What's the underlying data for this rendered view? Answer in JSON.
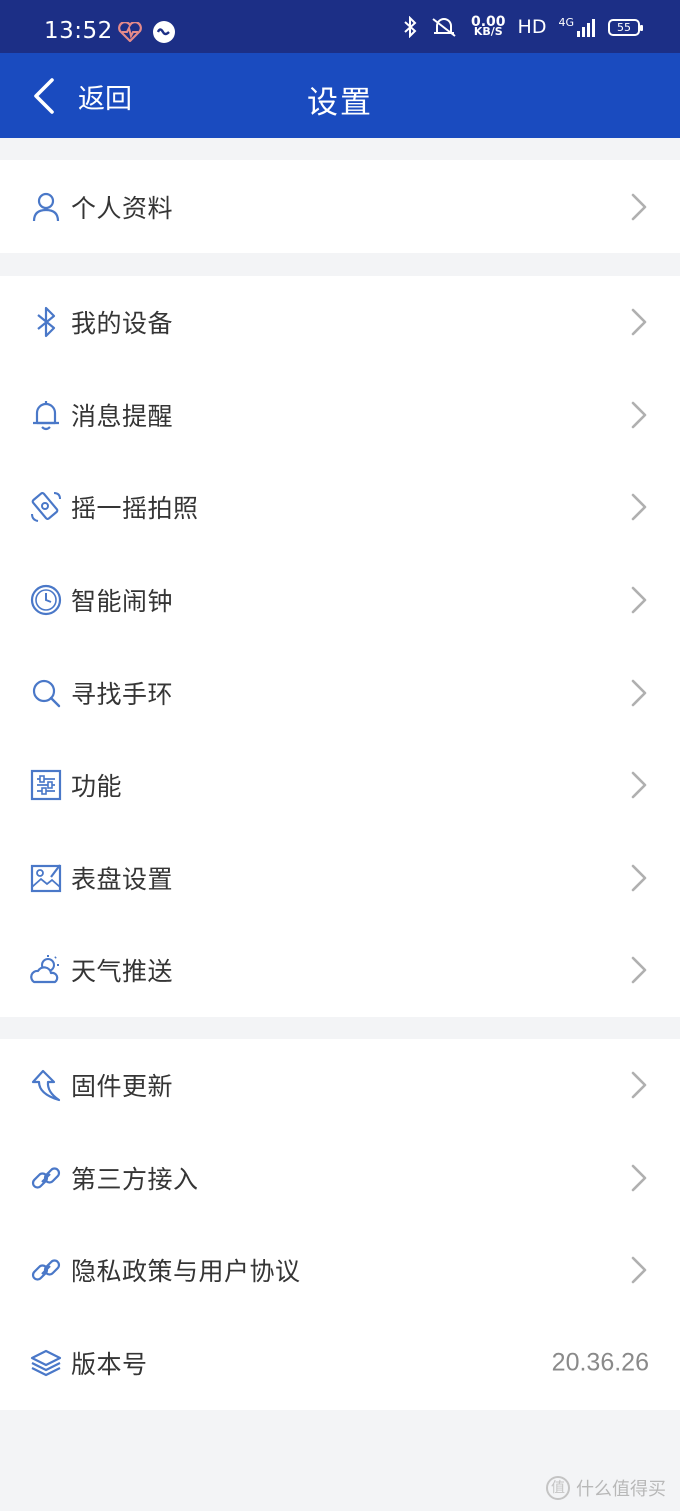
{
  "status_bar": {
    "time": "13:52",
    "speed_value": "0.00",
    "speed_unit": "KB/S",
    "hd": "HD",
    "network": "4G",
    "battery": "55"
  },
  "header": {
    "back_label": "返回",
    "title": "设置"
  },
  "groups": [
    {
      "items": [
        {
          "label": "个人资料",
          "icon": "person-icon"
        }
      ]
    },
    {
      "items": [
        {
          "label": "我的设备",
          "icon": "bluetooth-icon"
        },
        {
          "label": "消息提醒",
          "icon": "bell-icon"
        },
        {
          "label": "摇一摇拍照",
          "icon": "shake-camera-icon"
        },
        {
          "label": "智能闹钟",
          "icon": "clock-icon"
        },
        {
          "label": "寻找手环",
          "icon": "search-icon"
        },
        {
          "label": "功能",
          "icon": "sliders-icon"
        },
        {
          "label": "表盘设置",
          "icon": "image-edit-icon"
        },
        {
          "label": "天气推送",
          "icon": "weather-icon"
        }
      ]
    },
    {
      "items": [
        {
          "label": "固件更新",
          "icon": "update-arrow-icon"
        },
        {
          "label": "第三方接入",
          "icon": "link-icon"
        },
        {
          "label": "隐私政策与用户协议",
          "icon": "link-icon"
        },
        {
          "label": "版本号",
          "icon": "layers-icon",
          "value": "20.36.26"
        }
      ]
    }
  ],
  "watermark": {
    "text": "什么值得买",
    "logo": "值"
  },
  "colors": {
    "status_bar": "#1c2f86",
    "header": "#1a4bbf",
    "icon": "#4a78c8",
    "chevron": "#b0b0b0"
  }
}
